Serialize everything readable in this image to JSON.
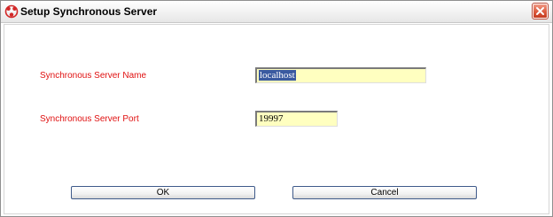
{
  "window": {
    "title": "Setup Synchronous Server"
  },
  "form": {
    "server_name_label": "Synchronous Server Name",
    "server_name_value": "localhost",
    "server_port_label": "Synchronous Server Port",
    "server_port_value": "19997"
  },
  "buttons": {
    "ok_label": "OK",
    "cancel_label": "Cancel"
  },
  "colors": {
    "label_red": "#e01010",
    "field_yellow": "#ffffc0",
    "button_border": "#3f5a8a"
  },
  "icons": {
    "app": "app-logo-icon",
    "close": "close-icon"
  }
}
